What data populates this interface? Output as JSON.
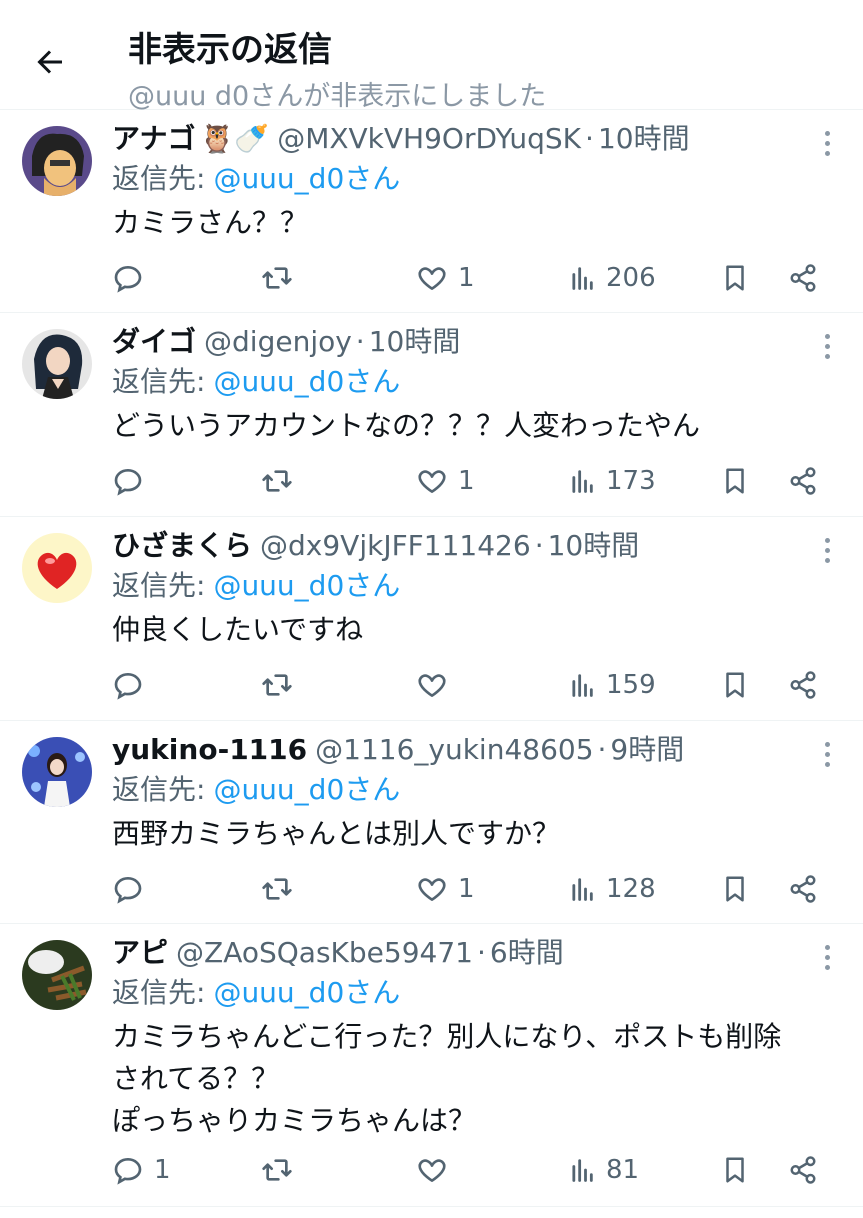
{
  "header": {
    "title": "非表示の返信",
    "subtitle": "@uuu d0さんが非表示にしました"
  },
  "replies": [
    {
      "name": "アナゴ",
      "emoji": "🦉🍼",
      "handle": "@MXVkVH9OrDYuqSK",
      "time": "10時間",
      "reply_label": "返信先:",
      "mention": "@uuu_d0さん",
      "text": [
        "カミラさん？？"
      ],
      "counts": {
        "reply": "",
        "retweet": "",
        "like": "1",
        "views": "206"
      }
    },
    {
      "name": "ダイゴ",
      "emoji": "",
      "handle": "@digenjoy",
      "time": "10時間",
      "reply_label": "返信先:",
      "mention": "@uuu_d0さん",
      "text": [
        "どういうアカウントなの？？？人変わったやん"
      ],
      "counts": {
        "reply": "",
        "retweet": "",
        "like": "1",
        "views": "173"
      }
    },
    {
      "name": "ひざまくら",
      "emoji": "",
      "handle": "@dx9VjkJFF111426",
      "time": "10時間",
      "reply_label": "返信先:",
      "mention": "@uuu_d0さん",
      "text": [
        "仲良くしたいですね"
      ],
      "counts": {
        "reply": "",
        "retweet": "",
        "like": "",
        "views": "159"
      }
    },
    {
      "name": "yukino-1116",
      "emoji": "",
      "handle": "@1116_yukin48605",
      "time": "9時間",
      "reply_label": "返信先:",
      "mention": "@uuu_d0さん",
      "text": [
        "西野カミラちゃんとは別人ですか？"
      ],
      "counts": {
        "reply": "",
        "retweet": "",
        "like": "1",
        "views": "128"
      }
    },
    {
      "name": "アピ",
      "emoji": "",
      "handle": "@ZAoSQasKbe59471",
      "time": "6時間",
      "reply_label": "返信先:",
      "mention": "@uuu_d0さん",
      "text": [
        "カミラちゃんどこ行った？別人になり、ポストも削除",
        "されてる？？",
        "ぽっちゃりカミラちゃんは？"
      ],
      "counts": {
        "reply": "1",
        "retweet": "",
        "like": "",
        "views": "81"
      }
    }
  ],
  "icons": {
    "back": "arrow-left-icon",
    "more": "more-vertical-icon",
    "reply": "reply-icon",
    "retweet": "retweet-icon",
    "like": "heart-icon",
    "views": "views-icon",
    "bookmark": "bookmark-icon",
    "share": "share-icon"
  },
  "colors": {
    "text": "#0f1419",
    "secondary": "#536471",
    "link": "#1d9bf0",
    "divider": "#eff3f4"
  }
}
